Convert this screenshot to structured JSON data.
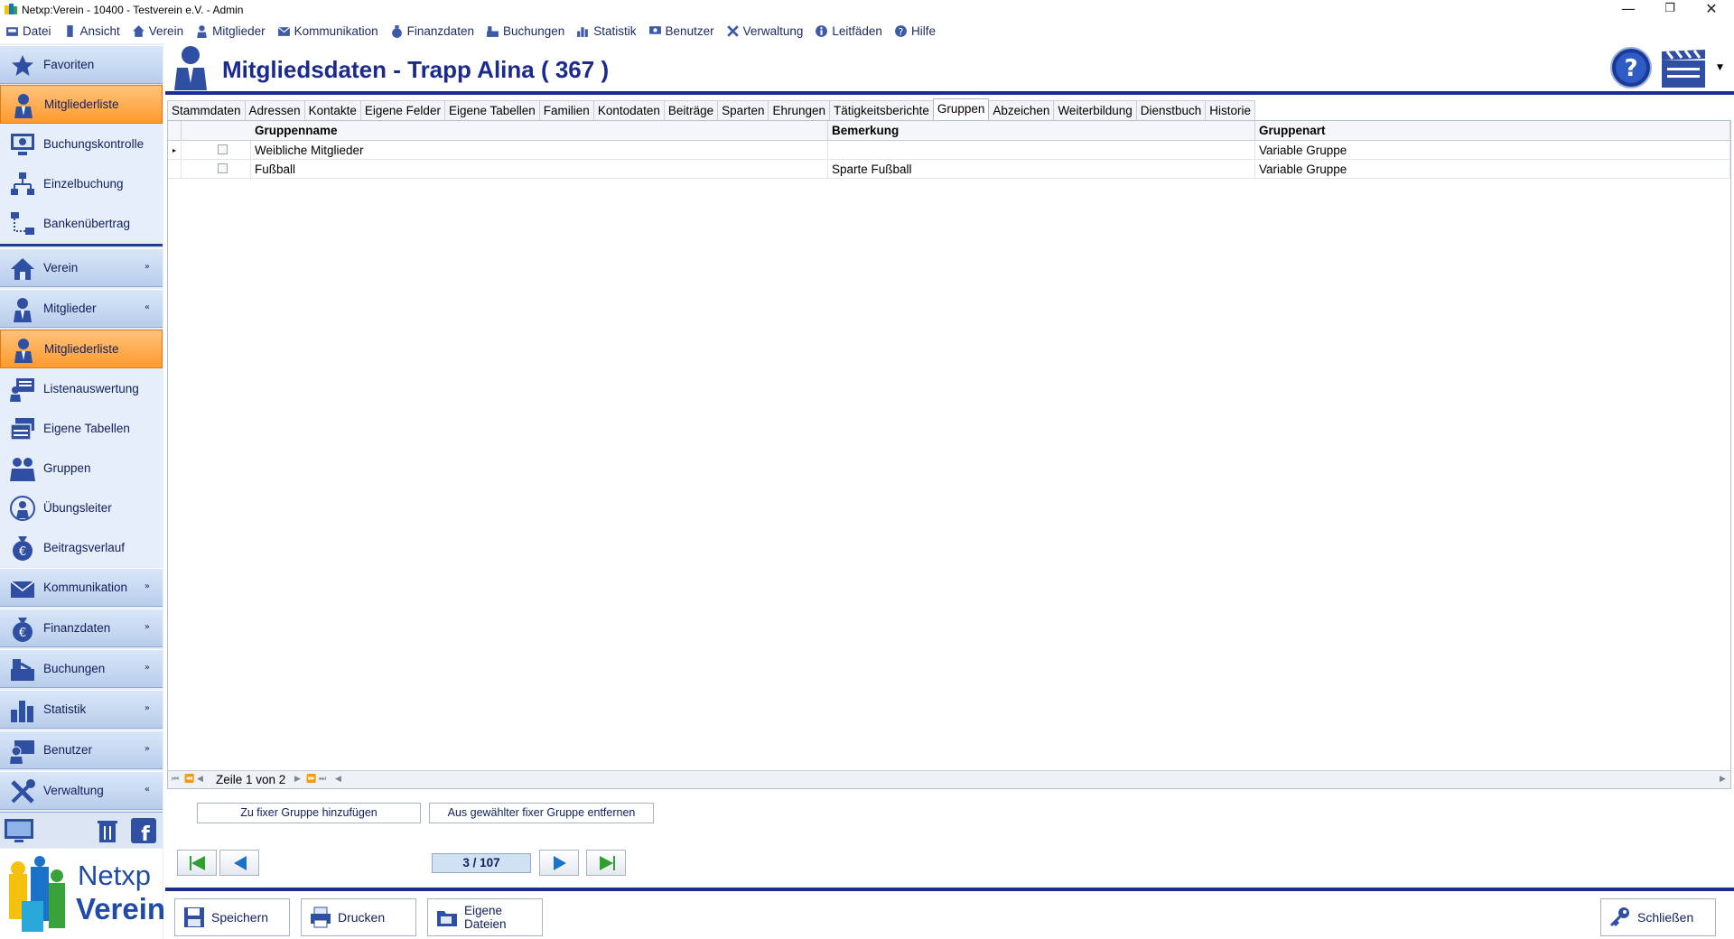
{
  "window": {
    "title": "Netxp:Verein - 10400 - Testverein e.V. - Admin",
    "controls": [
      "—",
      "❐",
      "✕"
    ]
  },
  "menubar": [
    {
      "label": "Datei",
      "icon": "file-icon"
    },
    {
      "label": "Ansicht",
      "icon": "view-icon"
    },
    {
      "label": "Verein",
      "icon": "home-icon"
    },
    {
      "label": "Mitglieder",
      "icon": "member-icon"
    },
    {
      "label": "Kommunikation",
      "icon": "envelope-icon"
    },
    {
      "label": "Finanzdaten",
      "icon": "money-bag-icon"
    },
    {
      "label": "Buchungen",
      "icon": "cash-register-icon"
    },
    {
      "label": "Statistik",
      "icon": "bar-chart-icon"
    },
    {
      "label": "Benutzer",
      "icon": "user-icon"
    },
    {
      "label": "Verwaltung",
      "icon": "tools-icon"
    },
    {
      "label": "Leitfäden",
      "icon": "info-icon"
    },
    {
      "label": "Hilfe",
      "icon": "help-icon"
    }
  ],
  "sidebar": {
    "favoriten": "Favoriten",
    "fav_items": [
      "Mitgliederliste",
      "Buchungskontrolle",
      "Einzelbuchung",
      "Bankenübertrag"
    ],
    "verein": "Verein",
    "mitglieder": "Mitglieder",
    "mitglieder_items": [
      "Mitgliederliste",
      "Listenauswertung",
      "Eigene Tabellen",
      "Gruppen",
      "Übungsleiter",
      "Beitragsverlauf"
    ],
    "sections": [
      "Kommunikation",
      "Finanzdaten",
      "Buchungen",
      "Statistik",
      "Benutzer",
      "Verwaltung"
    ],
    "logo_line1": "Netxp",
    "logo_line2": "Verein"
  },
  "header": {
    "title": "Mitgliedsdaten - Trapp Alina ( 367 )"
  },
  "tabs": [
    "Stammdaten",
    "Adressen",
    "Kontakte",
    "Eigene Felder",
    "Eigene Tabellen",
    "Familien",
    "Kontodaten",
    "Beiträge",
    "Sparten",
    "Ehrungen",
    "Tätigkeitsberichte",
    "Gruppen",
    "Abzeichen",
    "Weiterbildung",
    "Dienstbuch",
    "Historie"
  ],
  "active_tab": "Gruppen",
  "grid": {
    "columns": [
      "Gruppenname",
      "Bemerkung",
      "Gruppenart"
    ],
    "rows": [
      {
        "gruppenname": "Weibliche Mitglieder",
        "bemerkung": "",
        "gruppenart": "Variable Gruppe"
      },
      {
        "gruppenname": "Fußball",
        "bemerkung": "Sparte Fußball",
        "gruppenart": "Variable Gruppe"
      }
    ],
    "pager_text": "Zeile 1 von 2"
  },
  "actions": {
    "add_fixed": "Zu fixer Gruppe hinzufügen",
    "remove_fixed": "Aus gewählter fixer Gruppe entfernen"
  },
  "navigation": {
    "counter": "3 / 107"
  },
  "bottom": {
    "save": "Speichern",
    "print": "Drucken",
    "own_files_line1": "Eigene",
    "own_files_line2": "Dateien",
    "close": "Schließen"
  },
  "colors": {
    "accent_blue": "#1a2e8f",
    "orange": "#ff9a2e",
    "sidebar_bg": "#e6eefa",
    "nav_green": "#2fa02f"
  }
}
